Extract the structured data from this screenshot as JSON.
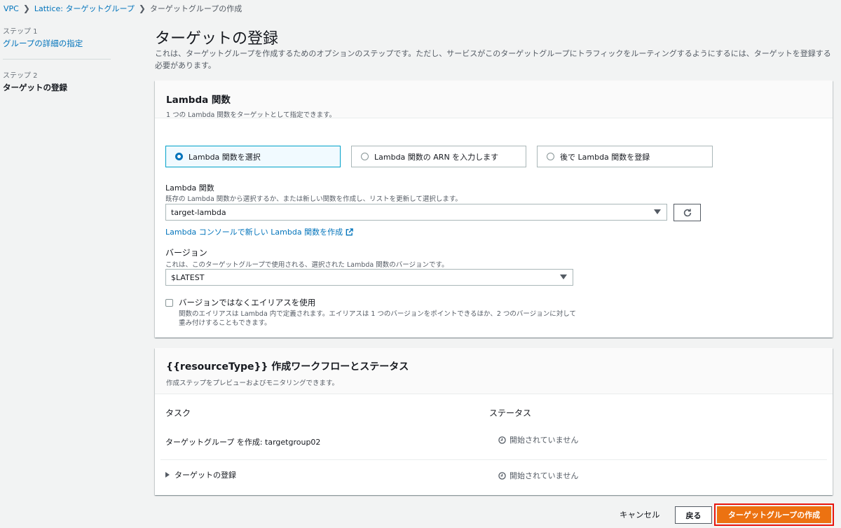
{
  "breadcrumb": {
    "items": [
      "VPC",
      "Lattice: ターゲットグループ",
      "ターゲットグループの作成"
    ]
  },
  "sidebar": {
    "steps": [
      {
        "step": "ステップ 1",
        "title": "グループの詳細の指定"
      },
      {
        "step": "ステップ 2",
        "title": "ターゲットの登録"
      }
    ]
  },
  "main": {
    "title": "ターゲットの登録",
    "description": "これは、ターゲットグループを作成するためのオプションのステップです。ただし、サービスがこのターゲットグループにトラフィックをルーティングするようにするには、ターゲットを登録する必要があります。"
  },
  "lambda_panel": {
    "title": "Lambda 関数",
    "subtitle": "1 つの Lambda 関数をターゲットとして指定できます。",
    "options": [
      {
        "label": "Lambda 関数を選択",
        "selected": true
      },
      {
        "label": "Lambda 関数の ARN を入力します",
        "selected": false
      },
      {
        "label": "後で Lambda 関数を登録",
        "selected": false
      }
    ],
    "function_label": "Lambda 関数",
    "function_desc": "既存の Lambda 関数から選択するか、または新しい関数を作成し、リストを更新して選択します。",
    "function_value": "target-lambda",
    "console_link": "Lambda コンソールで新しい Lambda 関数を作成",
    "version_label": "バージョン",
    "version_desc": "これは、このターゲットグループで使用される、選択された Lambda 関数のバージョンです。",
    "version_value": "$LATEST",
    "alias_label": "バージョンではなくエイリアスを使用",
    "alias_desc": "関数のエイリアスは Lambda 内で定義されます。エイリアスは 1 つのバージョンをポイントできるほか、2 つのバージョンに対して重み付けすることもできます。"
  },
  "workflow_panel": {
    "title": "{{resourceType}} 作成ワークフローとステータス",
    "subtitle": "作成ステップをプレビューおよびモニタリングできます。",
    "col_task": "タスク",
    "col_status": "ステータス",
    "rows": [
      {
        "task": "ターゲットグループ を作成: targetgroup02",
        "status": "開始されていません"
      },
      {
        "task": "ターゲットの登録",
        "status": "開始されていません"
      }
    ]
  },
  "footer": {
    "cancel": "キャンセル",
    "back": "戻る",
    "create": "ターゲットグループの作成"
  },
  "colors": {
    "accent": "#0073bb",
    "primary_button": "#ec7211",
    "highlight_border": "#e8150d"
  }
}
